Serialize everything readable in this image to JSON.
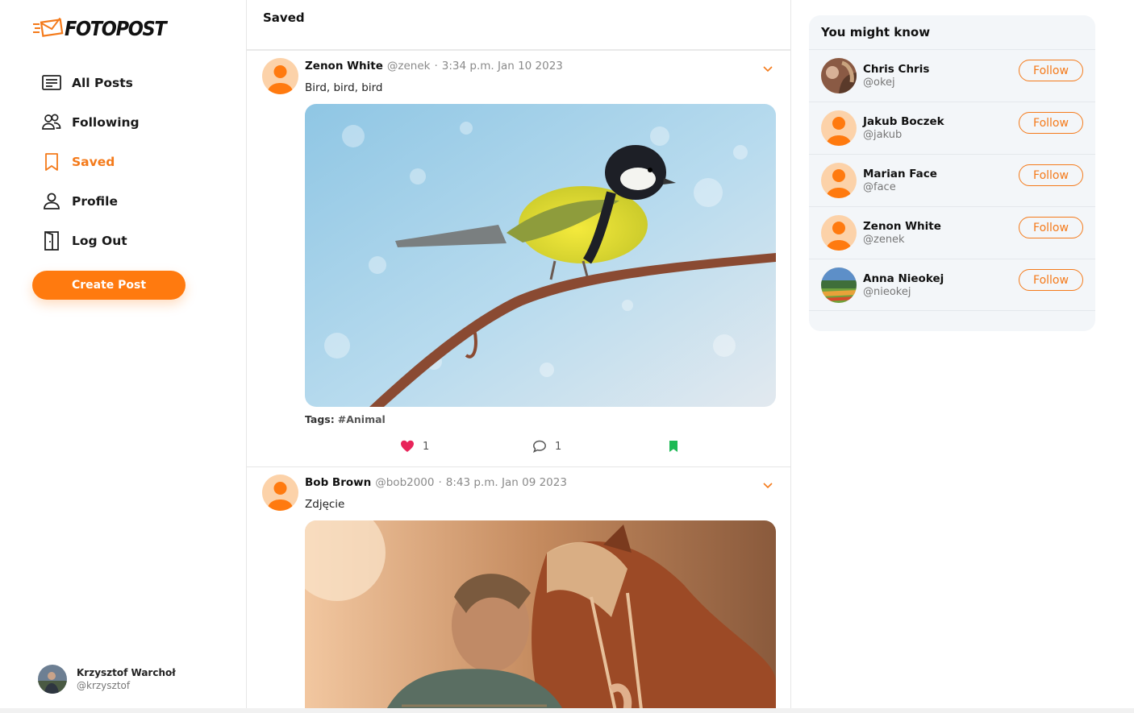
{
  "app": {
    "logo_text": "FOTOPOST"
  },
  "nav": {
    "items": [
      {
        "label": "All Posts",
        "icon": "list-icon"
      },
      {
        "label": "Following",
        "icon": "users-icon"
      },
      {
        "label": "Saved",
        "icon": "bookmark-icon",
        "active": true
      },
      {
        "label": "Profile",
        "icon": "user-icon"
      },
      {
        "label": "Log Out",
        "icon": "door-icon"
      }
    ],
    "create_post_label": "Create Post"
  },
  "current_user": {
    "name": "Krzysztof Warchoł",
    "handle": "@krzysztof"
  },
  "feed": {
    "title": "Saved",
    "posts": [
      {
        "author": "Zenon White",
        "handle": "@zenek",
        "separator": "·",
        "time": "3:34 p.m. Jan 10 2023",
        "text": "Bird, bird, bird",
        "tags_label": "Tags:",
        "tags": "#Animal",
        "likes": "1",
        "comments": "1"
      },
      {
        "author": "Bob Brown",
        "handle": "@bob2000",
        "separator": "·",
        "time": "8:43 p.m. Jan 09 2023",
        "text": "Zdjęcie"
      }
    ]
  },
  "suggestions": {
    "title": "You might know",
    "follow_label": "Follow",
    "users": [
      {
        "name": "Chris Chris",
        "handle": "@okej"
      },
      {
        "name": "Jakub Boczek",
        "handle": "@jakub"
      },
      {
        "name": "Marian Face",
        "handle": "@face"
      },
      {
        "name": "Zenon White",
        "handle": "@zenek"
      },
      {
        "name": "Anna Nieokej",
        "handle": "@nieokej"
      }
    ]
  },
  "colors": {
    "accent": "#f47a1a",
    "button": "#ff7a0f",
    "like": "#e8245a",
    "saved": "#1db954"
  }
}
